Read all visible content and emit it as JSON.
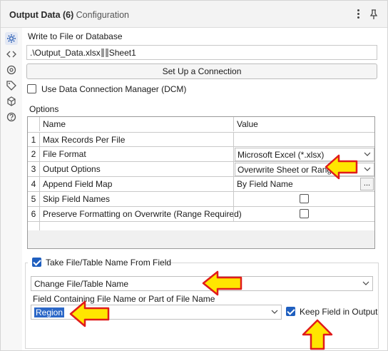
{
  "header": {
    "title": "Output Data (6)",
    "subtitle": "- Configuration"
  },
  "write_to": {
    "label": "Write to File or Database",
    "path_prefix": ".\\Output_Data.xlsx",
    "path_suffix": "Sheet1",
    "setup_button": "Set Up a Connection",
    "dcm_label": "Use Data Connection Manager (DCM)"
  },
  "options": {
    "label": "Options",
    "columns": [
      "Name",
      "Value"
    ],
    "rows": [
      {
        "num": "1",
        "name": "Max Records Per File",
        "value": ""
      },
      {
        "num": "2",
        "name": "File Format",
        "value": "Microsoft Excel (*.xlsx)"
      },
      {
        "num": "3",
        "name": "Output Options",
        "value": "Overwrite Sheet or Range"
      },
      {
        "num": "4",
        "name": "Append Field Map",
        "value": "By Field Name",
        "button": "..."
      },
      {
        "num": "5",
        "name": "Skip Field Names",
        "checked": false
      },
      {
        "num": "6",
        "name": "Preserve Formatting on Overwrite (Range Required)",
        "checked": false
      }
    ]
  },
  "take_name": {
    "label": "Take File/Table Name From Field",
    "checked": true,
    "mode": "Change File/Table Name",
    "field_label": "Field Containing File Name or Part of File Name",
    "field_value": "Region",
    "keep_label": "Keep Field in Output",
    "keep_checked": true
  },
  "colors": {
    "accent": "#1f5fbf",
    "arrow_fill": "#ffe600",
    "arrow_stroke": "#e01b1b"
  }
}
